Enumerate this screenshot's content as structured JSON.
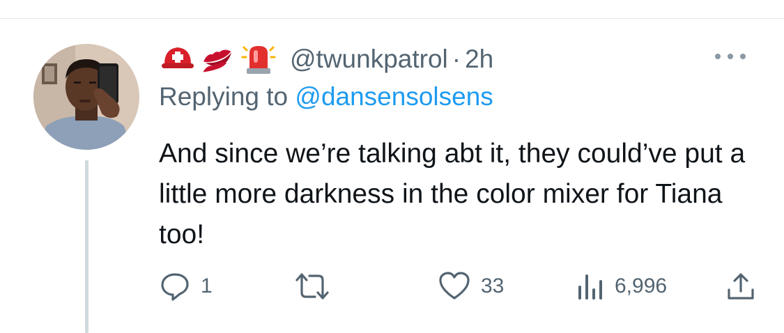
{
  "tweet": {
    "author_badges": [
      "rescue-helmet-icon",
      "kiss-mark-icon",
      "police-light-icon"
    ],
    "handle": "@twunkpatrol",
    "separator": "·",
    "time": "2h",
    "replying_to_prefix": "Replying to ",
    "replying_to_handle": "@dansensolsens",
    "text": "And since we’re talking abt it, they could’ve put a little more darkness in the color mixer for Tiana too!"
  },
  "actions": {
    "reply_count": "1",
    "retweet_count": "",
    "like_count": "33",
    "views_count": "6,996"
  },
  "colors": {
    "secondary_text": "#536471",
    "link": "#1d9bf0",
    "thread_line": "#cfd9de",
    "primary_text": "#0f1419"
  }
}
